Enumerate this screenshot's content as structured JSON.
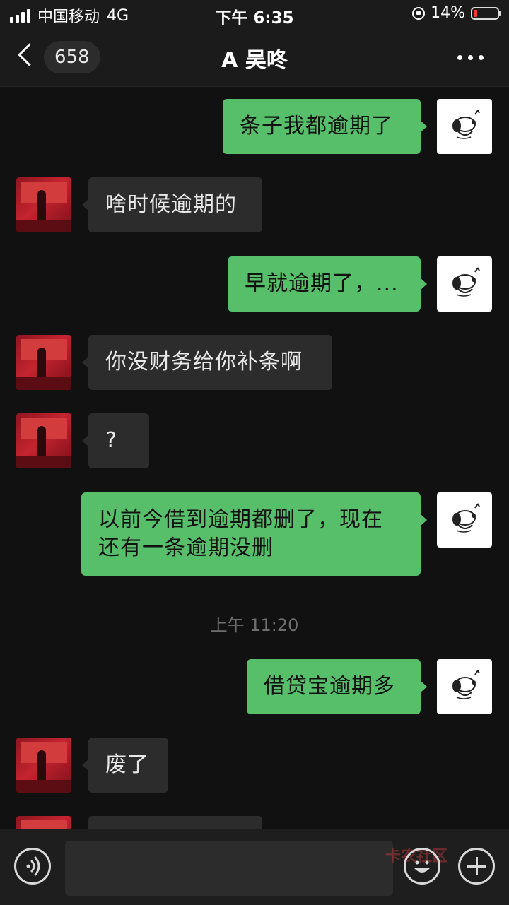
{
  "status_bar": {
    "carrier": "中国移动",
    "network": "4G",
    "time": "下午 6:35",
    "battery_percent": "14%",
    "battery_level": 0.14
  },
  "nav": {
    "unread_count": "658",
    "title": "A 吴咚",
    "more_icon": "more-horizontal-icon"
  },
  "messages": [
    {
      "sender": "self",
      "text": "条子我都逾期了"
    },
    {
      "sender": "other",
      "text": "啥时候逾期的"
    },
    {
      "sender": "self",
      "text": "早就逾期了，..."
    },
    {
      "sender": "other",
      "text": "你没财务给你补条啊"
    },
    {
      "sender": "other",
      "text": "?"
    },
    {
      "sender": "self",
      "text": "以前今借到逾期都删了，现在还有一条逾期没删"
    },
    {
      "sender": "system",
      "text": "上午 11:20"
    },
    {
      "sender": "self",
      "text": "借贷宝逾期多"
    },
    {
      "sender": "other",
      "text": "废了"
    }
  ],
  "input_bar": {
    "voice_icon": "voice-icon",
    "emoji_icon": "emoji-icon",
    "plus_icon": "plus-icon",
    "watermark": "卡农社区"
  },
  "colors": {
    "self_bubble": "#57be6a",
    "other_bubble": "#2c2c2c",
    "background": "#111111"
  }
}
